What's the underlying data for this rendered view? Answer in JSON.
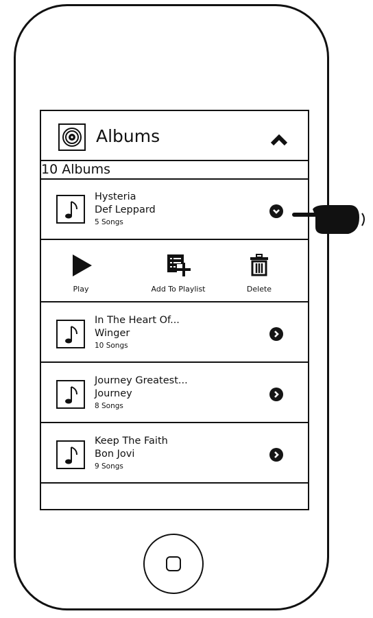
{
  "header": {
    "title": "Albums",
    "icon": "vinyl-record-icon",
    "collapse_icon": "chevron-up-icon"
  },
  "album_count_label": "10 Albums",
  "albums": [
    {
      "title": "Hysteria",
      "artist": "Def Leppard",
      "songs": "5 Songs",
      "expanded": true
    },
    {
      "title": "In The Heart Of...",
      "artist": "Winger",
      "songs": "10 Songs",
      "expanded": false
    },
    {
      "title": "Journey Greatest...",
      "artist": "Journey",
      "songs": "8 Songs",
      "expanded": false
    },
    {
      "title": "Keep The Faith",
      "artist": "Bon Jovi",
      "songs": "9 Songs",
      "expanded": false
    }
  ],
  "actions": {
    "play": "Play",
    "add_to_playlist": "Add To Playlist",
    "delete": "Delete"
  }
}
